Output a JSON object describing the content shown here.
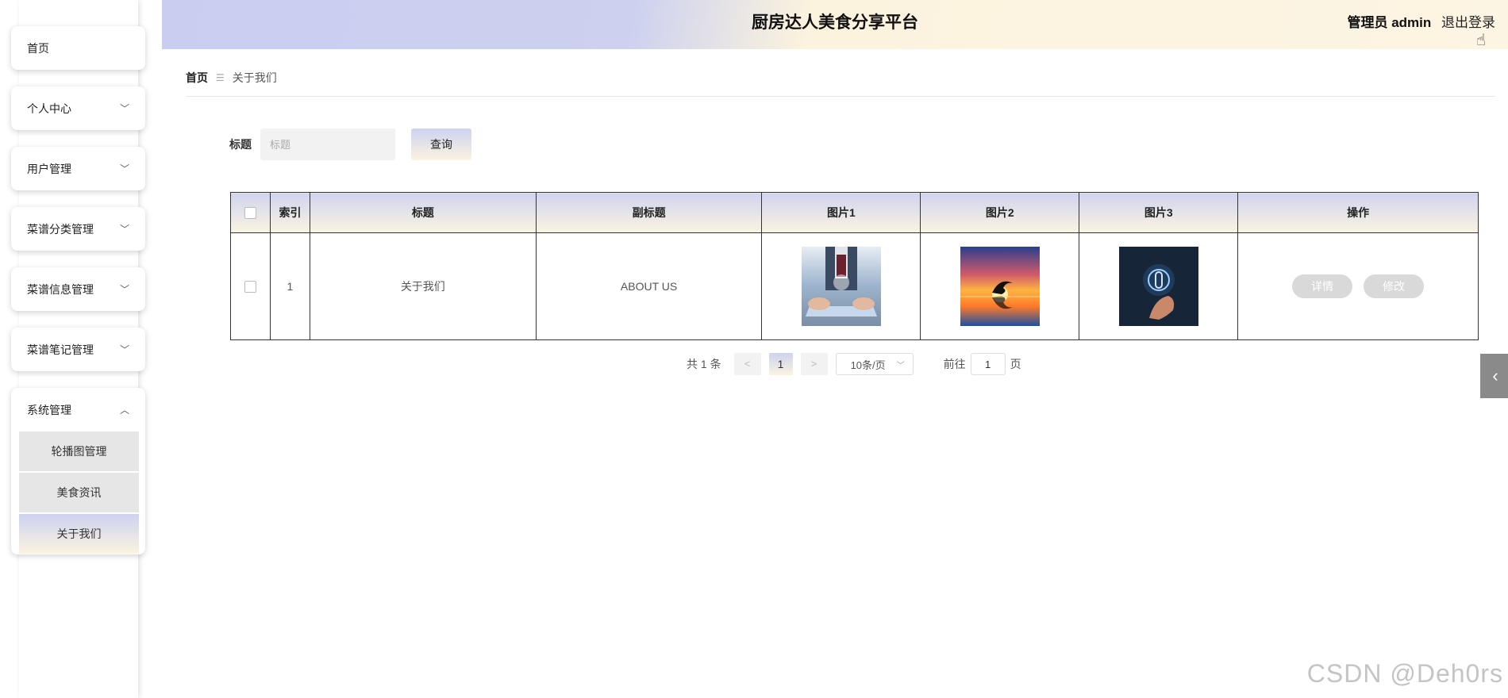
{
  "header": {
    "title": "厨房达人美食分享平台",
    "user_label": "管理员 admin",
    "logout": "退出登录"
  },
  "sidebar": {
    "items": [
      {
        "label": "首页",
        "chevron": ""
      },
      {
        "label": "个人中心",
        "chevron": "﹀"
      },
      {
        "label": "用户管理",
        "chevron": "﹀"
      },
      {
        "label": "菜谱分类管理",
        "chevron": "﹀"
      },
      {
        "label": "菜谱信息管理",
        "chevron": "﹀"
      },
      {
        "label": "菜谱笔记管理",
        "chevron": "﹀"
      }
    ],
    "system": {
      "label": "系统管理",
      "chevron": "︿",
      "subitems": [
        {
          "label": "轮播图管理"
        },
        {
          "label": "美食资讯"
        },
        {
          "label": "关于我们"
        }
      ]
    }
  },
  "breadcrumb": {
    "home": "首页",
    "separator": "☰",
    "current": "关于我们"
  },
  "search": {
    "label": "标题",
    "placeholder": "标题",
    "value": "",
    "button": "查询"
  },
  "table": {
    "columns": [
      "",
      "索引",
      "标题",
      "副标题",
      "图片1",
      "图片2",
      "图片3",
      "操作"
    ],
    "rows": [
      {
        "index": "1",
        "title": "关于我们",
        "subtitle": "ABOUT US",
        "detail": "详情",
        "edit": "修改"
      }
    ]
  },
  "pagination": {
    "total": "共 1 条",
    "prev": "<",
    "page": "1",
    "next": ">",
    "page_size": "10条/页",
    "size_chevron": "﹀",
    "goto_label": "前往",
    "goto_value": "1",
    "goto_suffix": "页"
  },
  "side_toggle": "‹",
  "watermark": "CSDN @Deh0rs"
}
